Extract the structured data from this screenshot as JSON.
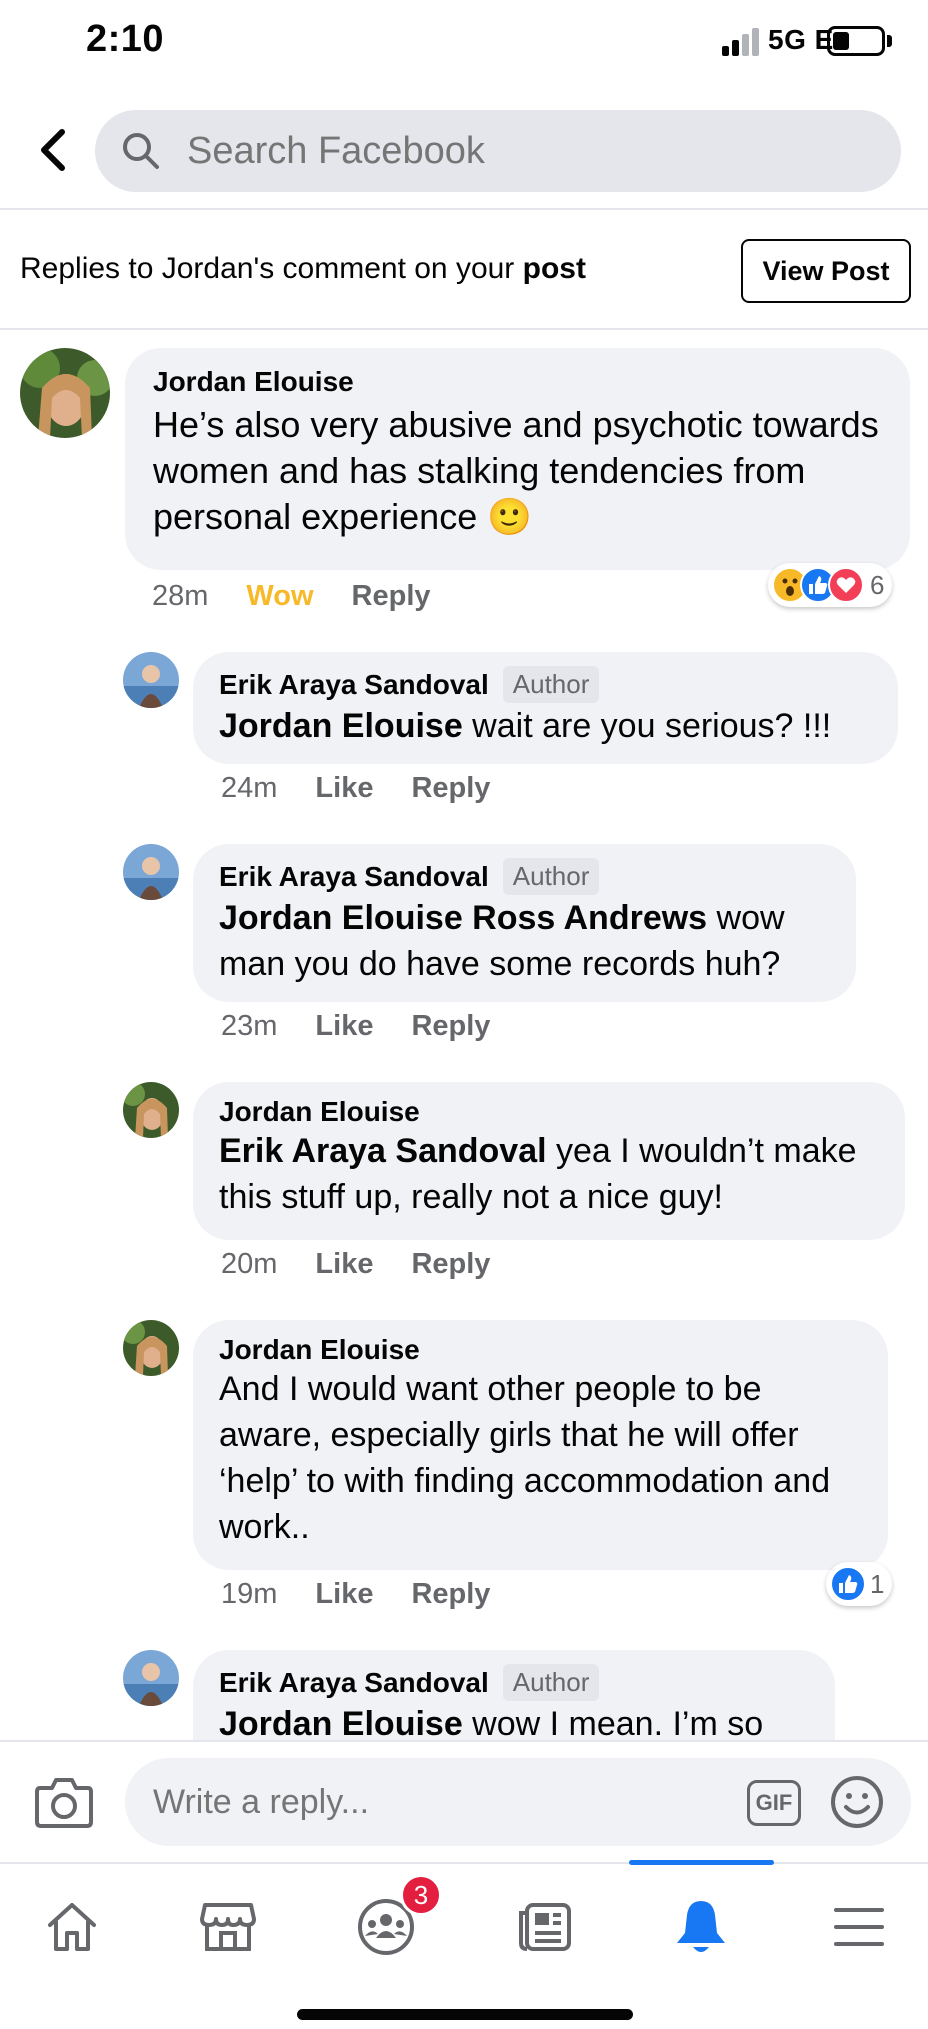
{
  "status_bar": {
    "time": "2:10",
    "network": "5G E"
  },
  "search": {
    "placeholder": "Search Facebook"
  },
  "context": {
    "prefix": "Replies to Jordan's comment on your ",
    "emphasis": "post",
    "view_post_label": "View Post"
  },
  "main_comment": {
    "author": "Jordan Elouise",
    "text": "He’s also very abusive and psychotic towards women and has stalking tendencies from personal experience 🙂",
    "time": "28m",
    "reaction_label": "Wow",
    "reply_label": "Reply",
    "reaction_count": "6",
    "reaction_icons": [
      "wow-icon",
      "like-icon",
      "love-icon"
    ]
  },
  "replies": [
    {
      "author": "Erik Araya Sandoval",
      "badge": "Author",
      "mention": "Jordan Elouise",
      "text": " wait are you serious? !!!",
      "time": "24m",
      "like_label": "Like",
      "reply_label": "Reply"
    },
    {
      "author": "Erik Araya Sandoval",
      "badge": "Author",
      "mention": "Jordan Elouise Ross Andrews",
      "text": " wow man you do have some records huh?",
      "time": "23m",
      "like_label": "Like",
      "reply_label": "Reply"
    },
    {
      "author": "Jordan Elouise",
      "badge": "",
      "mention": "Erik Araya Sandoval",
      "text": " yea I wouldn’t make this stuff up, really not a nice guy!",
      "time": "20m",
      "like_label": "Like",
      "reply_label": "Reply"
    },
    {
      "author": "Jordan Elouise",
      "badge": "",
      "mention": "",
      "text": "And I would want other people to be aware, especially girls that he will offer ‘help’ to with finding accommodation and work..",
      "time": "19m",
      "like_label": "Like",
      "reply_label": "Reply",
      "reaction_count": "1"
    },
    {
      "author": "Erik Araya Sandoval",
      "badge": "Author",
      "mention": "Jordan Elouise",
      "text": "  wow I mean. I’m so"
    }
  ],
  "composer": {
    "placeholder": "Write a reply...",
    "gif_label": "GIF"
  },
  "bottom_nav": {
    "items": [
      "home-icon",
      "marketplace-icon",
      "groups-icon",
      "news-icon",
      "notifications-icon",
      "menu-icon"
    ],
    "active": "notifications-icon",
    "groups_badge": "3"
  },
  "colors": {
    "accent": "#1877f2",
    "wow": "#f7b928",
    "badge": "#e41e3f",
    "bubble": "#f0f2f5"
  }
}
